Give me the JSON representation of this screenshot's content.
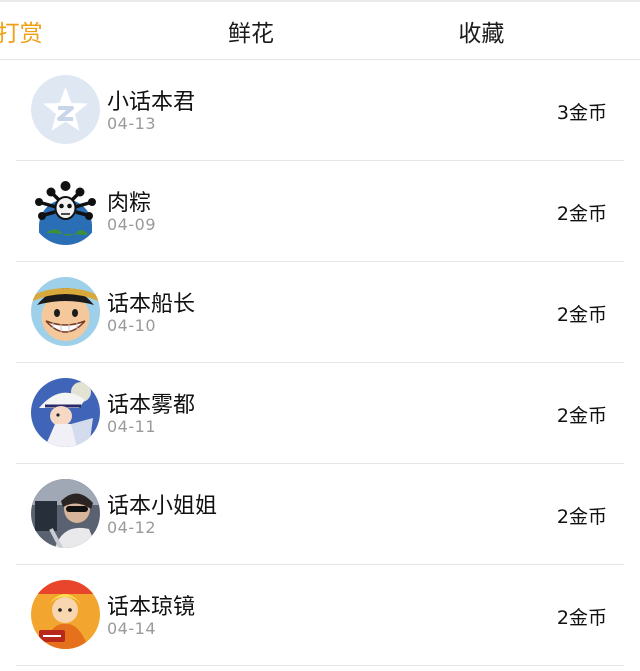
{
  "tabs": [
    {
      "label": "打赏",
      "active": true
    },
    {
      "label": "鲜花",
      "active": false
    },
    {
      "label": "收藏",
      "active": false
    }
  ],
  "colors": {
    "accent": "#f0a017",
    "divider": "#e6e6e6",
    "date": "#9a9a9a"
  },
  "rewards": [
    {
      "name": "小话本君",
      "date": "04-13",
      "amount": "3金币",
      "avatar_icon": "star-logo-avatar"
    },
    {
      "name": "肉粽",
      "date": "04-09",
      "amount": "2金币",
      "avatar_icon": "skull-globe-avatar"
    },
    {
      "name": "话本船长",
      "date": "04-10",
      "amount": "2金币",
      "avatar_icon": "straw-hat-cartoon-avatar"
    },
    {
      "name": "话本雾都",
      "date": "04-11",
      "amount": "2金币",
      "avatar_icon": "white-hat-cartoon-avatar"
    },
    {
      "name": "话本小姐姐",
      "date": "04-12",
      "amount": "2金币",
      "avatar_icon": "photo-avatar"
    },
    {
      "name": "话本琼镜",
      "date": "04-14",
      "amount": "2金币",
      "avatar_icon": "orange-cartoon-avatar"
    }
  ]
}
